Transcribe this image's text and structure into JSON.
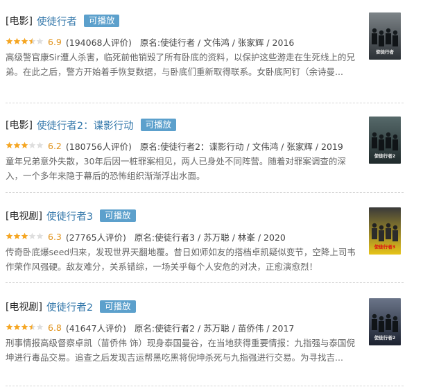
{
  "results": [
    {
      "category": "[电影]",
      "title": "使徒行者",
      "badge": "可播放",
      "stars_filled": 3.5,
      "rating": "6.9",
      "votes": "(194068人评价)",
      "meta": "原名:使徒行者 / 文伟鸿 / 张家辉 / 2016",
      "description": "高级警官康Sir遭人杀害，临死前他销毁了所有卧底的资料，以保护这些游走在生死线上的兄弟。在此之后，警方开始着手恢复数据，与卧底们重新取得联系。女卧底阿钉（余诗曼...",
      "poster_text": "使徒行者",
      "poster_colors": [
        "#2c3136",
        "#7d8488"
      ]
    },
    {
      "category": "[电影]",
      "title": "使徒行者2：谍影行动",
      "badge": "可播放",
      "stars_filled": 3,
      "rating": "6.2",
      "votes": "(180756人评价)",
      "meta": "原名:使徒行者2：谍影行动 / 文伟鸿 / 张家辉 / 2019",
      "description": "童年兄弟意外失散，30年后因一桩罪案相见，两人已身处不同阵营。随着对罪案调查的深入，一个多年来隐于幕后的恐怖组织渐渐浮出水面。",
      "poster_text": "使徒行者2",
      "poster_colors": [
        "#1f2a2b",
        "#56696a"
      ]
    },
    {
      "category": "[电视剧]",
      "title": "使徒行者3",
      "badge": "可播放",
      "stars_filled": 3,
      "rating": "6.3",
      "votes": "(27765人评价)",
      "meta": "原名:使徒行者3 / 苏万聪 / 林峯 / 2020",
      "description": "传奇卧底爆seed归来，发现世界天翻地覆。昔日如师如友的搭档卓凯疑似变节，空降上司韦作荣作风强硬。敌友难分，关系错综，一场关乎每个人安危的对决，正愈演愈烈！",
      "poster_text": "使徒行者3",
      "poster_colors": [
        "#e7c419",
        "#3a3a3a"
      ]
    },
    {
      "category": "[电视剧]",
      "title": "使徒行者2",
      "badge": "可播放",
      "stars_filled": 3.5,
      "rating": "6.8",
      "votes": "(41647人评价)",
      "meta": "原名:使徒行者2 / 苏万聪 / 苗侨伟 / 2017",
      "description": "刑事情报高级督察卓凯（苗侨伟 饰）现身泰国曼谷，在当地获得重要情报：九指强与泰国倪坤进行毒品交易。追查之后发现吉运帮黑吃黑将倪坤杀死与九指强进行交易。为寻找吉...",
      "poster_text": "使徒行者2",
      "poster_colors": [
        "#1c2230",
        "#6a7488"
      ]
    }
  ],
  "colors": {
    "title_link": "#3377aa",
    "badge_bg": "#5ca0cc",
    "star": "#f5a623",
    "rating_num": "#e09015",
    "description": "#666666"
  }
}
